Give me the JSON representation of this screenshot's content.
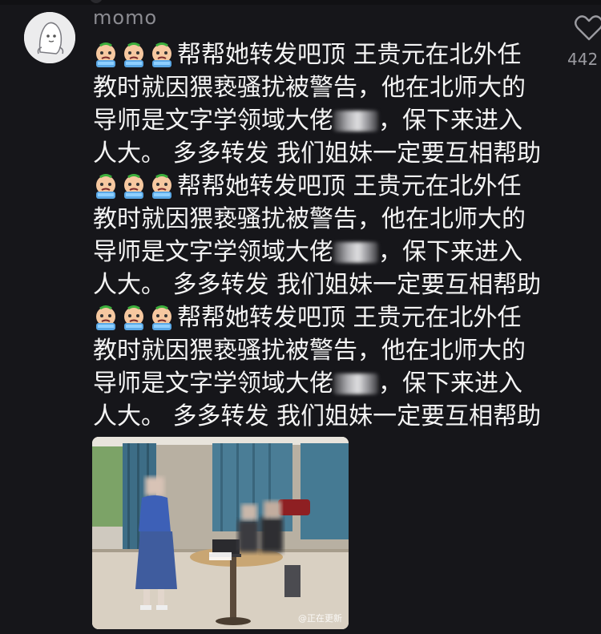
{
  "comment": {
    "username": "momo",
    "likes": "442",
    "emoji": "crying-face-emoji",
    "lines": [
      {
        "emoji": true,
        "text": "帮帮她转发吧顶 王贵元在北外任"
      },
      {
        "emoji": false,
        "text": "教时就因猥亵骚扰被警告，他在北师大的"
      },
      {
        "emoji": false,
        "text": "导师是文字学领域大佬",
        "redacted": true,
        "after": "，保下来进入"
      },
      {
        "emoji": false,
        "text": "人大。 多多转发 我们姐妹一定要互相帮助"
      },
      {
        "emoji": true,
        "text": "帮帮她转发吧顶 王贵元在北外任"
      },
      {
        "emoji": false,
        "text": "教时就因猥亵骚扰被警告，他在北师大的"
      },
      {
        "emoji": false,
        "text": "导师是文字学领域大佬",
        "redacted": true,
        "after": "，保下来进入"
      },
      {
        "emoji": false,
        "text": "人大。 多多转发 我们姐妹一定要互相帮助"
      },
      {
        "emoji": true,
        "text": "帮帮她转发吧顶 王贵元在北外任"
      },
      {
        "emoji": false,
        "text": "教时就因猥亵骚扰被警告，他在北师大的"
      },
      {
        "emoji": false,
        "text": "导师是文字学领域大佬",
        "redacted": true,
        "after": "，保下来进入"
      },
      {
        "emoji": false,
        "text": "人大。 多多转发 我们姐妹一定要互相帮助"
      }
    ],
    "photo_watermark": "@正在更新"
  },
  "colors": {
    "background": "#16161a",
    "text": "#f4f4f4",
    "muted": "#8c8c92"
  }
}
